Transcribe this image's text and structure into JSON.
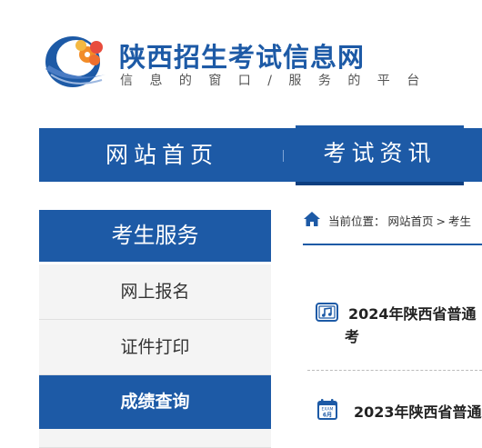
{
  "header": {
    "title": "陕西招生考试信息网",
    "slogan": "信 息 的 窗 口 / 服 务 的 平 台"
  },
  "nav": {
    "items": [
      {
        "label": "网站首页"
      },
      {
        "label": "考试资讯"
      }
    ]
  },
  "sidebar": {
    "heading": "考生服务",
    "items": [
      {
        "label": "网上报名"
      },
      {
        "label": "证件打印"
      },
      {
        "label": "成绩查询"
      }
    ]
  },
  "breadcrumb": {
    "prefix": "当前位置：",
    "home": "网站首页",
    "separator": ">",
    "current": "考生"
  },
  "articles": [
    {
      "title_line1": "2024年陕西省普通",
      "title_line2": "考",
      "icon": "music-note-icon"
    },
    {
      "title_line1": "2023年陕西省普通",
      "title_line2": "",
      "icon": "exam-calendar-icon",
      "icon_text_top": "EXAM",
      "icon_text_bottom": "6月"
    }
  ],
  "colors": {
    "brand_blue": "#1d5aa6",
    "sidebar_bg": "#f4f4f4"
  }
}
